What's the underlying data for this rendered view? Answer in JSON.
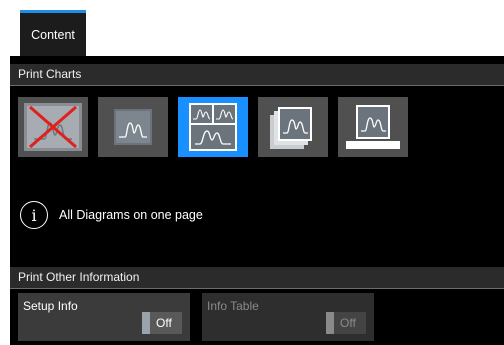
{
  "tabs": [
    {
      "label": "Content",
      "active": true
    }
  ],
  "print_charts": {
    "header": "Print Charts",
    "options": [
      {
        "icon": "no-charts-icon",
        "selected": false
      },
      {
        "icon": "single-chart-icon",
        "selected": false
      },
      {
        "icon": "all-diagrams-one-page-icon",
        "selected": true
      },
      {
        "icon": "one-diagram-per-page-icon",
        "selected": false
      },
      {
        "icon": "active-diagram-icon",
        "selected": false
      }
    ],
    "info_text": "All Diagrams on one page"
  },
  "other_info": {
    "header": "Print Other Information",
    "setup_info": {
      "label": "Setup Info",
      "state": "Off",
      "enabled": true
    },
    "info_table": {
      "label": "Info Table",
      "state": "Off",
      "enabled": false
    }
  },
  "colors": {
    "accent": "#1890ff",
    "tab_indicator": "#1f8fe6",
    "cross": "#e0201c"
  }
}
